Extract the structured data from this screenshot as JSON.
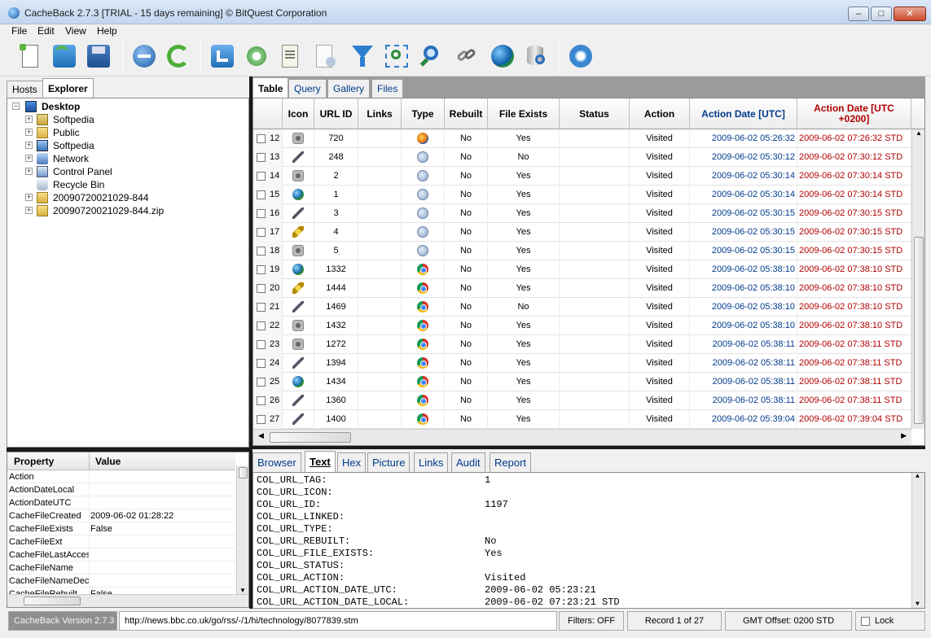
{
  "window": {
    "title": "CacheBack 2.7.3 [TRIAL - 15 days remaining] © BitQuest Corporation",
    "min_label": "–",
    "max_label": "□",
    "close_label": "✕"
  },
  "menu": [
    "File",
    "Edit",
    "View",
    "Help"
  ],
  "toolbar": {
    "icons": [
      "new-case-icon",
      "open-case-icon",
      "save-case-icon",
      "stop-icon",
      "refresh-icon",
      "export-icon",
      "settings-icon",
      "notes-icon",
      "report-icon",
      "filter-icon",
      "zoom-fit-icon",
      "search-icon",
      "link-icon",
      "web-globe-icon",
      "database-search-icon",
      "help-lifebuoy-icon"
    ]
  },
  "left_tabs": [
    "Hosts",
    "Explorer"
  ],
  "tree": {
    "root": "Desktop",
    "items": [
      {
        "label": "Softpedia",
        "icon": "user-folder-icon",
        "expander": "+"
      },
      {
        "label": "Public",
        "icon": "folder-icon",
        "expander": "+"
      },
      {
        "label": "Softpedia",
        "icon": "computer-icon",
        "expander": "+"
      },
      {
        "label": "Network",
        "icon": "network-icon",
        "expander": "+"
      },
      {
        "label": "Control Panel",
        "icon": "control-panel-icon",
        "expander": "+"
      },
      {
        "label": "Recycle Bin",
        "icon": "recycle-bin-icon",
        "expander": ""
      },
      {
        "label": "20090720021029-844",
        "icon": "folder-icon",
        "expander": "+"
      },
      {
        "label": "20090720021029-844.zip",
        "icon": "zip-folder-icon",
        "expander": "+"
      }
    ]
  },
  "properties": {
    "headers": [
      "Property",
      "Value"
    ],
    "rows": [
      {
        "key": "Action",
        "value": ""
      },
      {
        "key": "ActionDateLocal",
        "value": ""
      },
      {
        "key": "ActionDateUTC",
        "value": ""
      },
      {
        "key": "CacheFileCreated",
        "value": "2009-06-02 01:28:22"
      },
      {
        "key": "CacheFileExists",
        "value": "False"
      },
      {
        "key": "CacheFileExt",
        "value": ""
      },
      {
        "key": "CacheFileLastAcces",
        "value": ""
      },
      {
        "key": "CacheFileName",
        "value": ""
      },
      {
        "key": "CacheFileNameDecc",
        "value": ""
      },
      {
        "key": "CacheFileRebuilt",
        "value": "False"
      }
    ]
  },
  "right_tabs": [
    "Table",
    "Query",
    "Gallery",
    "Files"
  ],
  "grid": {
    "headers": [
      "Icon",
      "URL ID",
      "Links",
      "Type",
      "Rebuilt",
      "File Exists",
      "Status",
      "Action",
      "Action Date [UTC]",
      "Action Date [UTC +0200]"
    ],
    "rows": [
      {
        "n": "12",
        "icon": "camera",
        "id": "720",
        "type": "ff",
        "rebuilt": "No",
        "exists": "Yes",
        "action": "Visited",
        "utc": "2009-06-02 05:26:32",
        "local": "2009-06-02 07:26:32 STD"
      },
      {
        "n": "13",
        "icon": "pen",
        "id": "248",
        "type": "ie",
        "rebuilt": "No",
        "exists": "No",
        "action": "Visited",
        "utc": "2009-06-02 05:30:12",
        "local": "2009-06-02 07:30:12 STD"
      },
      {
        "n": "14",
        "icon": "camera",
        "id": "2",
        "type": "ie",
        "rebuilt": "No",
        "exists": "Yes",
        "action": "Visited",
        "utc": "2009-06-02 05:30:14",
        "local": "2009-06-02 07:30:14 STD"
      },
      {
        "n": "15",
        "icon": "globe",
        "id": "1",
        "type": "ie",
        "rebuilt": "No",
        "exists": "Yes",
        "action": "Visited",
        "utc": "2009-06-02 05:30:14",
        "local": "2009-06-02 07:30:14 STD"
      },
      {
        "n": "16",
        "icon": "pen",
        "id": "3",
        "type": "ie",
        "rebuilt": "No",
        "exists": "Yes",
        "action": "Visited",
        "utc": "2009-06-02 05:30:15",
        "local": "2009-06-02 07:30:15 STD"
      },
      {
        "n": "17",
        "icon": "flash",
        "id": "4",
        "type": "ie",
        "rebuilt": "No",
        "exists": "Yes",
        "action": "Visited",
        "utc": "2009-06-02 05:30:15",
        "local": "2009-06-02 07:30:15 STD"
      },
      {
        "n": "18",
        "icon": "camera",
        "id": "5",
        "type": "ie",
        "rebuilt": "No",
        "exists": "Yes",
        "action": "Visited",
        "utc": "2009-06-02 05:30:15",
        "local": "2009-06-02 07:30:15 STD"
      },
      {
        "n": "19",
        "icon": "globe",
        "id": "1332",
        "type": "ch",
        "rebuilt": "No",
        "exists": "Yes",
        "action": "Visited",
        "utc": "2009-06-02 05:38:10",
        "local": "2009-06-02 07:38:10 STD"
      },
      {
        "n": "20",
        "icon": "flash",
        "id": "1444",
        "type": "ch",
        "rebuilt": "No",
        "exists": "Yes",
        "action": "Visited",
        "utc": "2009-06-02 05:38:10",
        "local": "2009-06-02 07:38:10 STD"
      },
      {
        "n": "21",
        "icon": "pen",
        "id": "1469",
        "type": "ch",
        "rebuilt": "No",
        "exists": "No",
        "action": "Visited",
        "utc": "2009-06-02 05:38:10",
        "local": "2009-06-02 07:38:10 STD"
      },
      {
        "n": "22",
        "icon": "camera",
        "id": "1432",
        "type": "ch",
        "rebuilt": "No",
        "exists": "Yes",
        "action": "Visited",
        "utc": "2009-06-02 05:38:10",
        "local": "2009-06-02 07:38:10 STD"
      },
      {
        "n": "23",
        "icon": "camera",
        "id": "1272",
        "type": "ch",
        "rebuilt": "No",
        "exists": "Yes",
        "action": "Visited",
        "utc": "2009-06-02 05:38:11",
        "local": "2009-06-02 07:38:11 STD"
      },
      {
        "n": "24",
        "icon": "pen",
        "id": "1394",
        "type": "ch",
        "rebuilt": "No",
        "exists": "Yes",
        "action": "Visited",
        "utc": "2009-06-02 05:38:11",
        "local": "2009-06-02 07:38:11 STD"
      },
      {
        "n": "25",
        "icon": "globe",
        "id": "1434",
        "type": "ch",
        "rebuilt": "No",
        "exists": "Yes",
        "action": "Visited",
        "utc": "2009-06-02 05:38:11",
        "local": "2009-06-02 07:38:11 STD"
      },
      {
        "n": "26",
        "icon": "pen",
        "id": "1360",
        "type": "ch",
        "rebuilt": "No",
        "exists": "Yes",
        "action": "Visited",
        "utc": "2009-06-02 05:38:11",
        "local": "2009-06-02 07:38:11 STD"
      },
      {
        "n": "27",
        "icon": "pen",
        "id": "1400",
        "type": "ch",
        "rebuilt": "No",
        "exists": "Yes",
        "action": "Visited",
        "utc": "2009-06-02 05:39:04",
        "local": "2009-06-02 07:39:04 STD"
      }
    ]
  },
  "bottom_tabs": [
    "Browser",
    "Text",
    "Hex",
    "Picture",
    "Links",
    "Audit",
    "Report"
  ],
  "text_view": [
    {
      "k": "COL_URL_TAG:",
      "v": "1"
    },
    {
      "k": "COL_URL_ICON:",
      "v": ""
    },
    {
      "k": "COL_URL_ID:",
      "v": "1197"
    },
    {
      "k": "COL_URL_LINKED:",
      "v": ""
    },
    {
      "k": "COL_URL_TYPE:",
      "v": ""
    },
    {
      "k": "COL_URL_REBUILT:",
      "v": "No"
    },
    {
      "k": "COL_URL_FILE_EXISTS:",
      "v": "Yes"
    },
    {
      "k": "COL_URL_STATUS:",
      "v": ""
    },
    {
      "k": "COL_URL_ACTION:",
      "v": "Visited"
    },
    {
      "k": "COL_URL_ACTION_DATE_UTC:",
      "v": "2009-06-02 05:23:21"
    },
    {
      "k": "COL_URL_ACTION_DATE_LOCAL:",
      "v": "2009-06-02 07:23:21 STD"
    }
  ],
  "status": {
    "version": "CacheBack Version 2.7.3",
    "url": "http://news.bbc.co.uk/go/rss/-/1/hi/technology/8077839.stm",
    "filters": "Filters: OFF",
    "record": "Record 1 of 27",
    "gmt": "GMT Offset: 0200 STD",
    "lock": "Lock"
  },
  "colors": {
    "utc_date": "#003a8c",
    "local_date": "#b00000"
  }
}
